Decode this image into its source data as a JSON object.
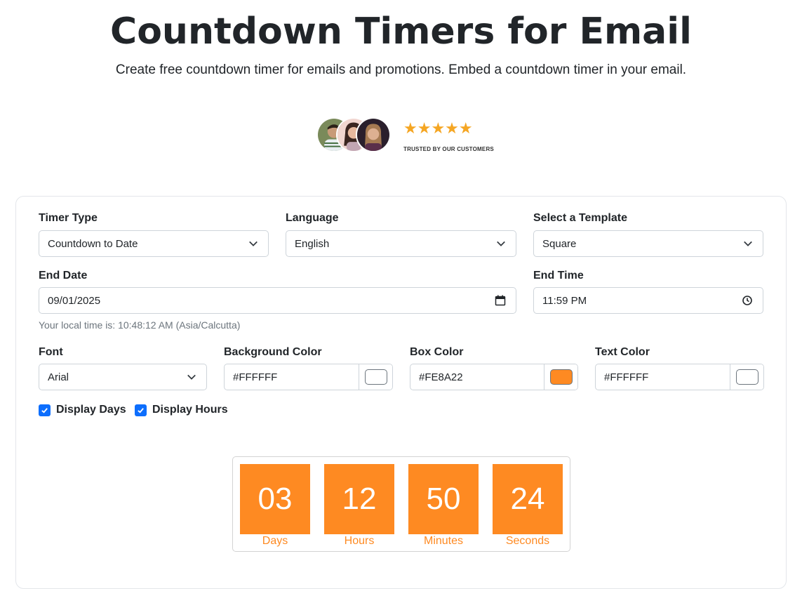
{
  "header": {
    "title": "Countdown Timers for Email",
    "subtitle": "Create free countdown timer for emails and promotions. Embed a countdown timer in your email."
  },
  "trust": {
    "stars": "★★★★★",
    "rating": 5,
    "label": "TRUSTED BY OUR CUSTOMERS",
    "avatars": [
      "avatar-man",
      "avatar-woman-1",
      "avatar-woman-2"
    ]
  },
  "form": {
    "timer_type": {
      "label": "Timer Type",
      "value": "Countdown to Date"
    },
    "language": {
      "label": "Language",
      "value": "English"
    },
    "template": {
      "label": "Select a Template",
      "value": "Square"
    },
    "end_date": {
      "label": "End Date",
      "value": "09/01/2025"
    },
    "end_time": {
      "label": "End Time",
      "value": "11:59 PM"
    },
    "local_time_hint": "Your local time is: 10:48:12 AM (Asia/Calcutta)",
    "font": {
      "label": "Font",
      "value": "Arial"
    },
    "background_color": {
      "label": "Background Color",
      "value": "#FFFFFF"
    },
    "box_color": {
      "label": "Box Color",
      "value": "#FE8A22"
    },
    "text_color": {
      "label": "Text Color",
      "value": "#FFFFFF"
    },
    "display_days": {
      "label": "Display Days",
      "checked": true
    },
    "display_hours": {
      "label": "Display Hours",
      "checked": true
    }
  },
  "preview": {
    "days": {
      "value": "03",
      "label": "Days"
    },
    "hours": {
      "value": "12",
      "label": "Hours"
    },
    "minutes": {
      "value": "50",
      "label": "Minutes"
    },
    "seconds": {
      "value": "24",
      "label": "Seconds"
    }
  },
  "colors": {
    "accent": "#FE8A22",
    "checkbox": "#0D6EFD",
    "star": "#F5A623"
  }
}
